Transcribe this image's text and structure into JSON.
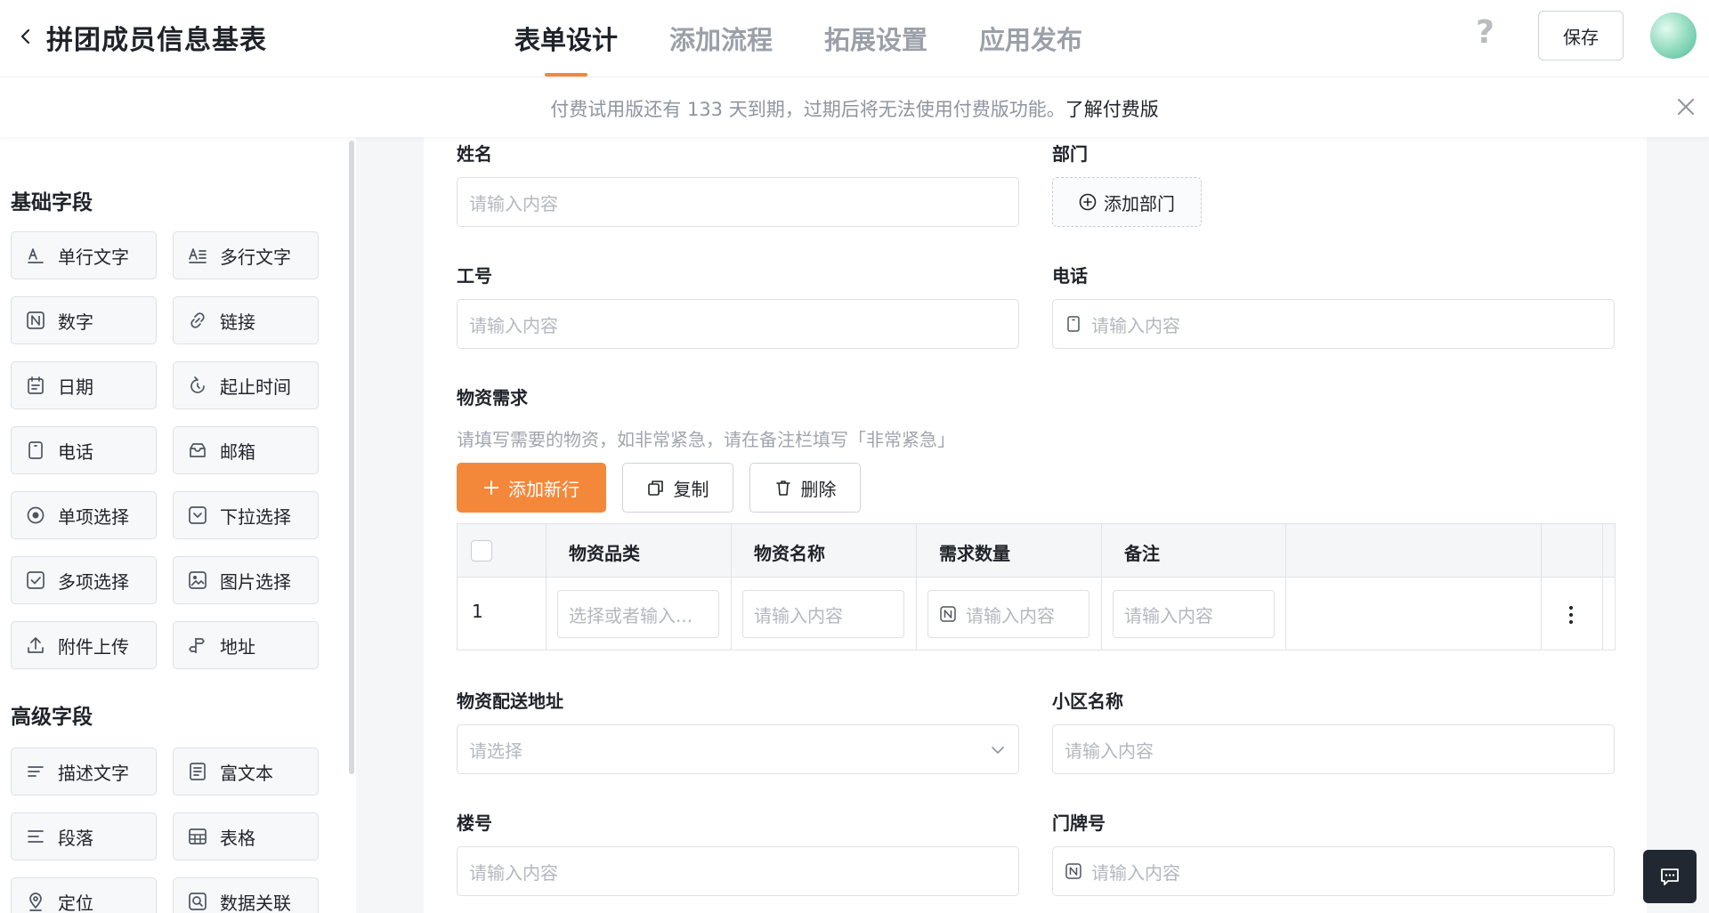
{
  "header": {
    "title": "拼团成员信息基表",
    "tabs": [
      {
        "label": "表单设计"
      },
      {
        "label": "添加流程"
      },
      {
        "label": "拓展设置"
      },
      {
        "label": "应用发布"
      }
    ],
    "help_label": "?",
    "save_label": "保存"
  },
  "notice": {
    "text": "付费试用版还有 133 天到期，过期后将无法使用付费版功能。",
    "link": "了解付费版"
  },
  "palette": {
    "basic_title": "基础字段",
    "basic_fields": [
      {
        "label": "单行文字",
        "icon": "single-line-text-icon"
      },
      {
        "label": "多行文字",
        "icon": "multi-line-text-icon"
      },
      {
        "label": "数字",
        "icon": "number-icon"
      },
      {
        "label": "链接",
        "icon": "link-icon"
      },
      {
        "label": "日期",
        "icon": "calendar-icon"
      },
      {
        "label": "起止时间",
        "icon": "time-range-icon"
      },
      {
        "label": "电话",
        "icon": "phone-icon"
      },
      {
        "label": "邮箱",
        "icon": "mail-icon"
      },
      {
        "label": "单项选择",
        "icon": "radio-icon"
      },
      {
        "label": "下拉选择",
        "icon": "dropdown-icon"
      },
      {
        "label": "多项选择",
        "icon": "checkbox-icon"
      },
      {
        "label": "图片选择",
        "icon": "image-icon"
      },
      {
        "label": "附件上传",
        "icon": "upload-icon"
      },
      {
        "label": "地址",
        "icon": "address-icon"
      }
    ],
    "advanced_title": "高级字段",
    "advanced_fields": [
      {
        "label": "描述文字",
        "icon": "description-icon"
      },
      {
        "label": "富文本",
        "icon": "rich-text-icon"
      },
      {
        "label": "段落",
        "icon": "paragraph-icon"
      },
      {
        "label": "表格",
        "icon": "table-icon"
      },
      {
        "label": "定位",
        "icon": "location-icon"
      },
      {
        "label": "数据关联",
        "icon": "data-link-icon"
      }
    ]
  },
  "form": {
    "name_label": "姓名",
    "name_placeholder": "请输入内容",
    "dept_label": "部门",
    "dept_button": "添加部门",
    "job_label": "工号",
    "job_placeholder": "请输入内容",
    "phone_label": "电话",
    "phone_placeholder": "请输入内容",
    "material": {
      "label": "物资需求",
      "hint": "请填写需要的物资，如非常紧急，请在备注栏填写「非常紧急」",
      "add_row": "添加新行",
      "copy": "复制",
      "delete": "删除",
      "columns": [
        "物资品类",
        "物资名称",
        "需求数量",
        "备注"
      ],
      "row_number": "1",
      "cells": [
        "选择或者输入...",
        "请输入内容",
        "请输入内容",
        "请输入内容"
      ]
    },
    "address_label": "物资配送地址",
    "address_placeholder": "请选择",
    "community_label": "小区名称",
    "community_placeholder": "请输入内容",
    "building_label": "楼号",
    "building_placeholder": "请输入内容",
    "door_label": "门牌号",
    "door_placeholder": "请输入内容"
  },
  "colors": {
    "accent": "#f4883a",
    "text": "#1f2329",
    "muted": "#9ba0a8"
  }
}
